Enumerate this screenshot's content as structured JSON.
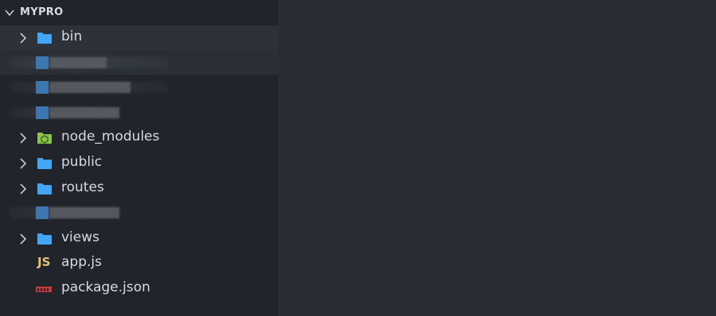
{
  "explorer": {
    "section_title": "MYPRO",
    "items": [
      {
        "label": "bin",
        "type": "folder",
        "icon": "folder-icon",
        "expandable": true
      },
      {
        "label": "node_modules",
        "type": "folder",
        "icon": "node-modules-folder-icon",
        "expandable": true
      },
      {
        "label": "public",
        "type": "folder",
        "icon": "folder-icon",
        "expandable": true
      },
      {
        "label": "routes",
        "type": "folder",
        "icon": "folder-icon",
        "expandable": true
      },
      {
        "label": "views",
        "type": "folder",
        "icon": "folder-icon",
        "expandable": true
      },
      {
        "label": "app.js",
        "type": "file",
        "icon": "js-file-icon",
        "icon_text": "JS",
        "expandable": false
      },
      {
        "label": "package.json",
        "type": "file",
        "icon": "npm-file-icon",
        "expandable": false
      }
    ]
  },
  "colors": {
    "sidebar_bg": "#21252b",
    "editor_bg": "#282c34",
    "folder_blue": "#42a5f5",
    "node_green": "#8bc34a",
    "js_yellow": "#e5c07b",
    "npm_red": "#cb3837",
    "text": "#d7dae0"
  }
}
